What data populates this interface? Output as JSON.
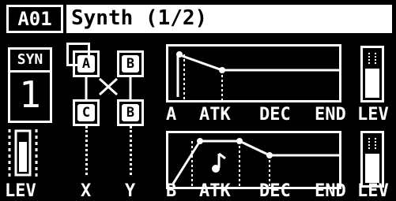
{
  "header": {
    "patch_id": "A01",
    "title": "Synth (1/2)"
  },
  "synth_type": {
    "label": "SYN",
    "value": "1"
  },
  "algorithm": {
    "operators": [
      "A",
      "B",
      "C",
      "B"
    ]
  },
  "envelope_a": {
    "label_op": "A",
    "label_atk": "ATK",
    "label_dec": "DEC",
    "label_end": "END",
    "label_lev": "LEV"
  },
  "envelope_b": {
    "label_op": "B",
    "label_atk": "ATK",
    "label_dec": "DEC",
    "label_end": "END",
    "label_lev": "LEV"
  },
  "bottom": {
    "lev": "LEV",
    "x": "X",
    "y": "Y"
  },
  "colors": {
    "background": "#000000",
    "foreground": "#ffffff"
  }
}
